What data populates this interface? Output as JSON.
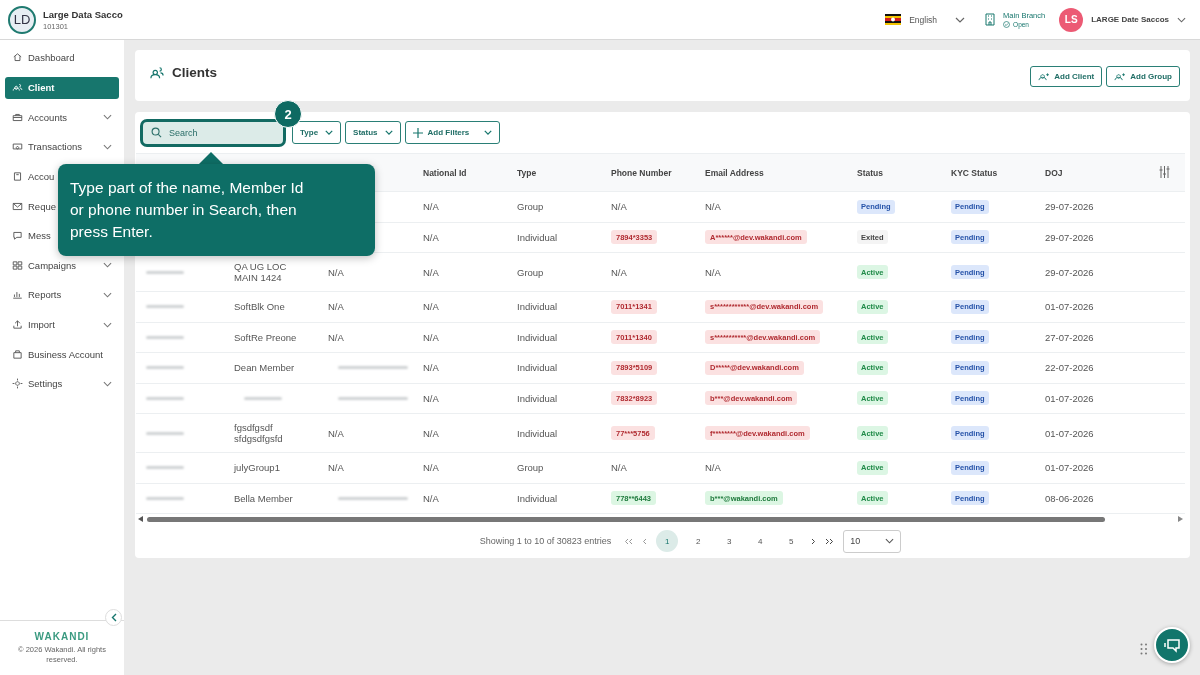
{
  "org": {
    "initials": "LD",
    "name": "Large Data Sacco",
    "code": "101301"
  },
  "topbar": {
    "language": "English",
    "branch": "Main Branch",
    "branch_status": "Open",
    "user_initials": "LS",
    "user_name": "LARGE Date Saccos"
  },
  "sidebar": {
    "items": [
      {
        "label": "Dashboard",
        "selected": false,
        "expandable": false
      },
      {
        "label": "Client",
        "selected": true,
        "expandable": false
      },
      {
        "label": "Accounts",
        "selected": false,
        "expandable": true
      },
      {
        "label": "Transactions",
        "selected": false,
        "expandable": true
      },
      {
        "label": "Accou",
        "selected": false
      },
      {
        "label": "Reque",
        "selected": false
      },
      {
        "label": "Mess",
        "selected": false
      },
      {
        "label": "Campaigns",
        "selected": false,
        "expandable": true
      },
      {
        "label": "Reports",
        "selected": false,
        "expandable": true
      },
      {
        "label": "Import",
        "selected": false,
        "expandable": true
      },
      {
        "label": "Business Account",
        "selected": false,
        "expandable": false
      },
      {
        "label": "Settings",
        "selected": false,
        "expandable": true
      }
    ]
  },
  "footer": {
    "logo": "WAKANDI",
    "copyright": "© 2026 Wakandi. All rights reserved."
  },
  "page": {
    "title": "Clients",
    "actions": [
      "Add Client",
      "Add Group"
    ]
  },
  "filters": {
    "search_placeholder": "Search",
    "dropdowns": [
      "Type",
      "Status"
    ],
    "add_filters": "Add Filters"
  },
  "tour": {
    "step": "2",
    "text": "Type part of the name, Member Id or phone number in Search, then press Enter."
  },
  "table": {
    "columns": [
      "National Id",
      "Type",
      "Phone Number",
      "Email Address",
      "Status",
      "KYC Status",
      "DOJ"
    ],
    "rows": [
      {
        "national_id": "N/A",
        "type": "Group",
        "phone": {
          "text": "N/A",
          "kind": "plain"
        },
        "email": {
          "text": "N/A",
          "kind": "plain"
        },
        "status": {
          "text": "Pending",
          "kind": "pending"
        },
        "kyc": {
          "text": "Pending",
          "kind": "pending"
        },
        "doj": "29-07-2026"
      },
      {
        "national_id": "N/A",
        "type": "Individual",
        "phone": {
          "text": "7894*3353",
          "kind": "warning"
        },
        "email": {
          "text": "A******@dev.wakandi.com",
          "kind": "warning"
        },
        "status": {
          "text": "Exited",
          "kind": "exited"
        },
        "kyc": {
          "text": "Pending",
          "kind": "pending"
        },
        "doj": "29-07-2026"
      },
      {
        "name": "QA UG LOC MAIN 1424",
        "reference": "N/A",
        "national_id": "N/A",
        "type": "Group",
        "phone": {
          "text": "N/A",
          "kind": "plain"
        },
        "email": {
          "text": "N/A",
          "kind": "plain"
        },
        "status": {
          "text": "Active",
          "kind": "active"
        },
        "kyc": {
          "text": "Pending",
          "kind": "pending"
        },
        "doj": "29-07-2026"
      },
      {
        "name": "SoftBlk One",
        "reference": "N/A",
        "national_id": "N/A",
        "type": "Individual",
        "phone": {
          "text": "7011*1341",
          "kind": "warning"
        },
        "email": {
          "text": "s************@dev.wakandi.com",
          "kind": "warning"
        },
        "status": {
          "text": "Active",
          "kind": "active"
        },
        "kyc": {
          "text": "Pending",
          "kind": "pending"
        },
        "doj": "01-07-2026"
      },
      {
        "name": "SoftRe Preone",
        "reference": "N/A",
        "national_id": "N/A",
        "type": "Individual",
        "phone": {
          "text": "7011*1340",
          "kind": "warning"
        },
        "email": {
          "text": "s***********@dev.wakandi.com",
          "kind": "warning"
        },
        "status": {
          "text": "Active",
          "kind": "active"
        },
        "kyc": {
          "text": "Pending",
          "kind": "pending"
        },
        "doj": "27-07-2026"
      },
      {
        "name": "Dean Member",
        "reference": null,
        "national_id": "N/A",
        "type": "Individual",
        "phone": {
          "text": "7893*5109",
          "kind": "warning"
        },
        "email": {
          "text": "D*****@dev.wakandi.com",
          "kind": "warning"
        },
        "status": {
          "text": "Active",
          "kind": "active"
        },
        "kyc": {
          "text": "Pending",
          "kind": "pending"
        },
        "doj": "22-07-2026"
      },
      {
        "name": null,
        "reference": null,
        "national_id": "N/A",
        "type": "Individual",
        "phone": {
          "text": "7832*8923",
          "kind": "warning"
        },
        "email": {
          "text": "b***@dev.wakandi.com",
          "kind": "warning"
        },
        "status": {
          "text": "Active",
          "kind": "active"
        },
        "kyc": {
          "text": "Pending",
          "kind": "pending"
        },
        "doj": "01-07-2026"
      },
      {
        "name": "fgsdfgsdf sfdgsdfgsfd",
        "reference": "N/A",
        "national_id": "N/A",
        "type": "Individual",
        "phone": {
          "text": "77***5756",
          "kind": "warning"
        },
        "email": {
          "text": "f********@dev.wakandi.com",
          "kind": "warning"
        },
        "status": {
          "text": "Active",
          "kind": "active"
        },
        "kyc": {
          "text": "Pending",
          "kind": "pending"
        },
        "doj": "01-07-2026"
      },
      {
        "name": "julyGroup1",
        "reference": "N/A",
        "national_id": "N/A",
        "type": "Group",
        "phone": {
          "text": "N/A",
          "kind": "plain"
        },
        "email": {
          "text": "N/A",
          "kind": "plain"
        },
        "status": {
          "text": "Active",
          "kind": "active"
        },
        "kyc": {
          "text": "Pending",
          "kind": "pending"
        },
        "doj": "01-07-2026"
      },
      {
        "name": "Bella Member",
        "reference": null,
        "national_id": "N/A",
        "type": "Individual",
        "phone": {
          "text": "778**6443",
          "kind": "success"
        },
        "email": {
          "text": "b***@wakandi.com",
          "kind": "success"
        },
        "status": {
          "text": "Active",
          "kind": "active"
        },
        "kyc": {
          "text": "Pending",
          "kind": "pending"
        },
        "doj": "08-06-2026"
      }
    ]
  },
  "pagination": {
    "summary": "Showing 1 to 10 of 30823 entries",
    "pages": [
      {
        "label": "1",
        "selected": true
      },
      {
        "label": "2",
        "selected": false
      },
      {
        "label": "3",
        "selected": false
      },
      {
        "label": "4",
        "selected": false
      },
      {
        "label": "5",
        "selected": false
      }
    ],
    "page_size": "10"
  }
}
